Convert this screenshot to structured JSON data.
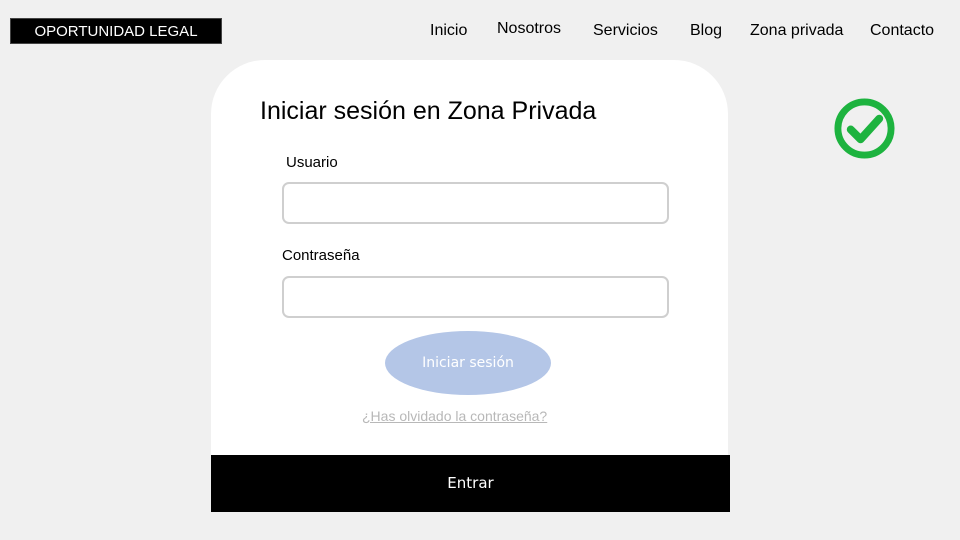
{
  "brand": {
    "logo_text": "OPORTUNIDAD LEGAL"
  },
  "nav": {
    "items": [
      {
        "label": "Inicio"
      },
      {
        "label": "Nosotros"
      },
      {
        "label": "Servicios"
      },
      {
        "label": "Blog"
      },
      {
        "label": "Zona privada"
      },
      {
        "label": "Contacto"
      }
    ]
  },
  "login": {
    "title": "Iniciar sesión en Zona Privada",
    "username_label": "Usuario",
    "username_value": "",
    "password_label": "Contraseña",
    "password_value": "",
    "submit_label": "Iniciar sesión",
    "forgot_link": "¿Has olvidado la contraseña?",
    "enter_label": "Entrar"
  },
  "status_icon": {
    "name": "check-circle-icon",
    "color": "#1db33f"
  },
  "colors": {
    "page_bg": "#f0f0f0",
    "card_bg": "#ffffff",
    "button_bg": "#b4c6e7",
    "bar_bg": "#000000"
  }
}
